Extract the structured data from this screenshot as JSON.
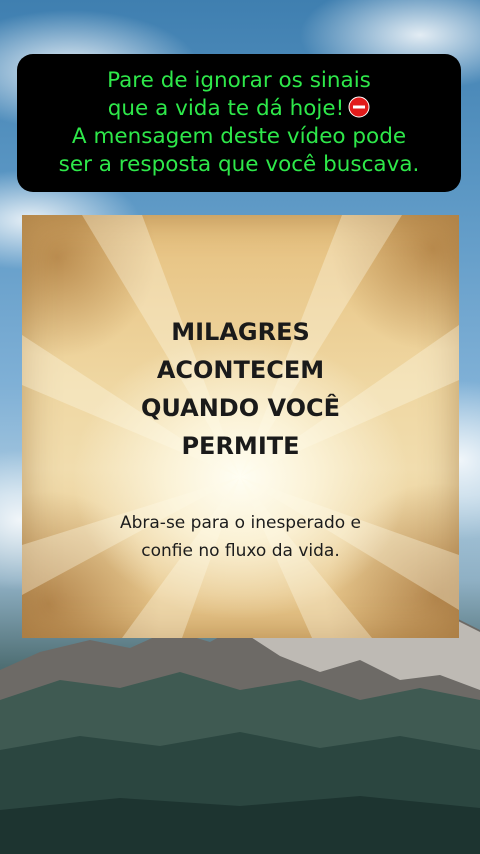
{
  "caption": {
    "lines": [
      "Pare de ignorar os sinais",
      "que a vida te dá hoje!",
      "A mensagem deste vídeo pode",
      "ser a resposta que você buscava."
    ],
    "icon": "stop-sign-icon",
    "text_color": "#2ee84a",
    "background_color": "#000000"
  },
  "card": {
    "title_lines": [
      "MILAGRES",
      "ACONTECEM",
      "QUANDO VOCÊ",
      "PERMITE"
    ],
    "subtitle_lines": [
      "Abra-se para o inesperado e",
      "confie no fluxo da vida."
    ]
  },
  "background": {
    "scene": "sky-with-clouds-and-mountains"
  }
}
